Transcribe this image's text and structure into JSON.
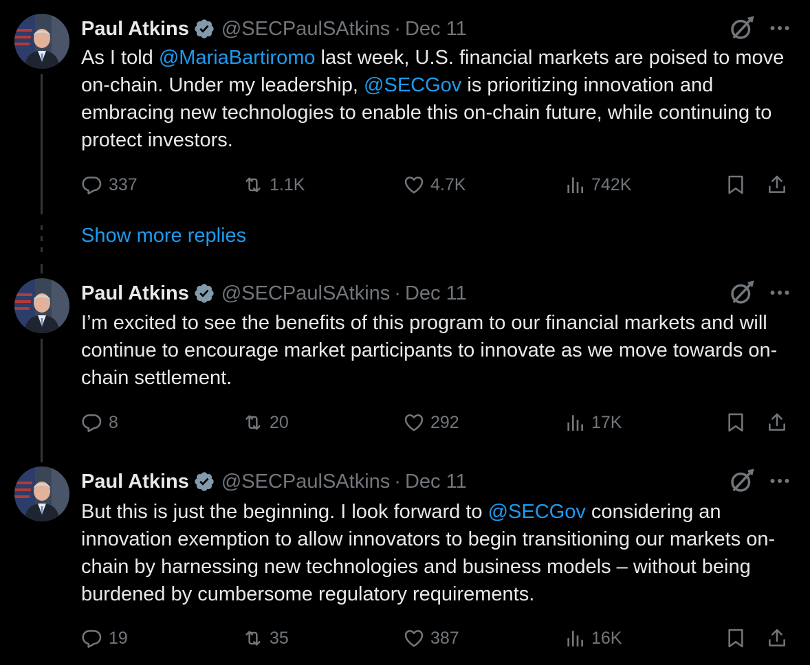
{
  "tweets": [
    {
      "name": "Paul Atkins",
      "handle": "@SECPaulSAtkins",
      "separator": "·",
      "date": "Dec 11",
      "text_parts": {
        "a": "As I told ",
        "b": "@MariaBartiromo",
        "c": " last week, U.S. financial markets are poised to move on-chain. Under my leadership, ",
        "d": "@SECGov",
        "e": " is prioritizing innovation and embracing new technologies to enable this on-chain future, while continuing to protect investors."
      },
      "replies": "337",
      "reposts": "1.1K",
      "likes": "4.7K",
      "views": "742K"
    },
    {
      "name": "Paul Atkins",
      "handle": "@SECPaulSAtkins",
      "separator": "·",
      "date": "Dec 11",
      "text_parts": {
        "a": "I’m excited to see the benefits of this program to our financial markets and will continue to encourage market participants to innovate as we move towards on-chain settlement."
      },
      "replies": "8",
      "reposts": "20",
      "likes": "292",
      "views": "17K"
    },
    {
      "name": "Paul Atkins",
      "handle": "@SECPaulSAtkins",
      "separator": "·",
      "date": "Dec 11",
      "text_parts": {
        "a": "But this is just the beginning. I look forward to ",
        "b": "@SECGov",
        "c": " considering an innovation exemption to allow innovators to begin transitioning our markets on-chain by harnessing new technologies and business models – without being burdened by cumbersome regulatory requirements."
      },
      "replies": "19",
      "reposts": "35",
      "likes": "387",
      "views": "16K"
    }
  ],
  "show_more_replies": "Show more replies",
  "icons": {
    "verified": "verified-badge-icon",
    "grok": "grok-icon",
    "more": "more-options-icon",
    "reply": "reply-icon",
    "repost": "repost-icon",
    "like": "like-icon",
    "views": "views-icon",
    "bookmark": "bookmark-icon",
    "share": "share-icon"
  },
  "colors": {
    "background": "#000000",
    "text": "#e7e9ea",
    "muted": "#71767b",
    "link": "#1d9bf0",
    "thread_line": "#333639"
  }
}
